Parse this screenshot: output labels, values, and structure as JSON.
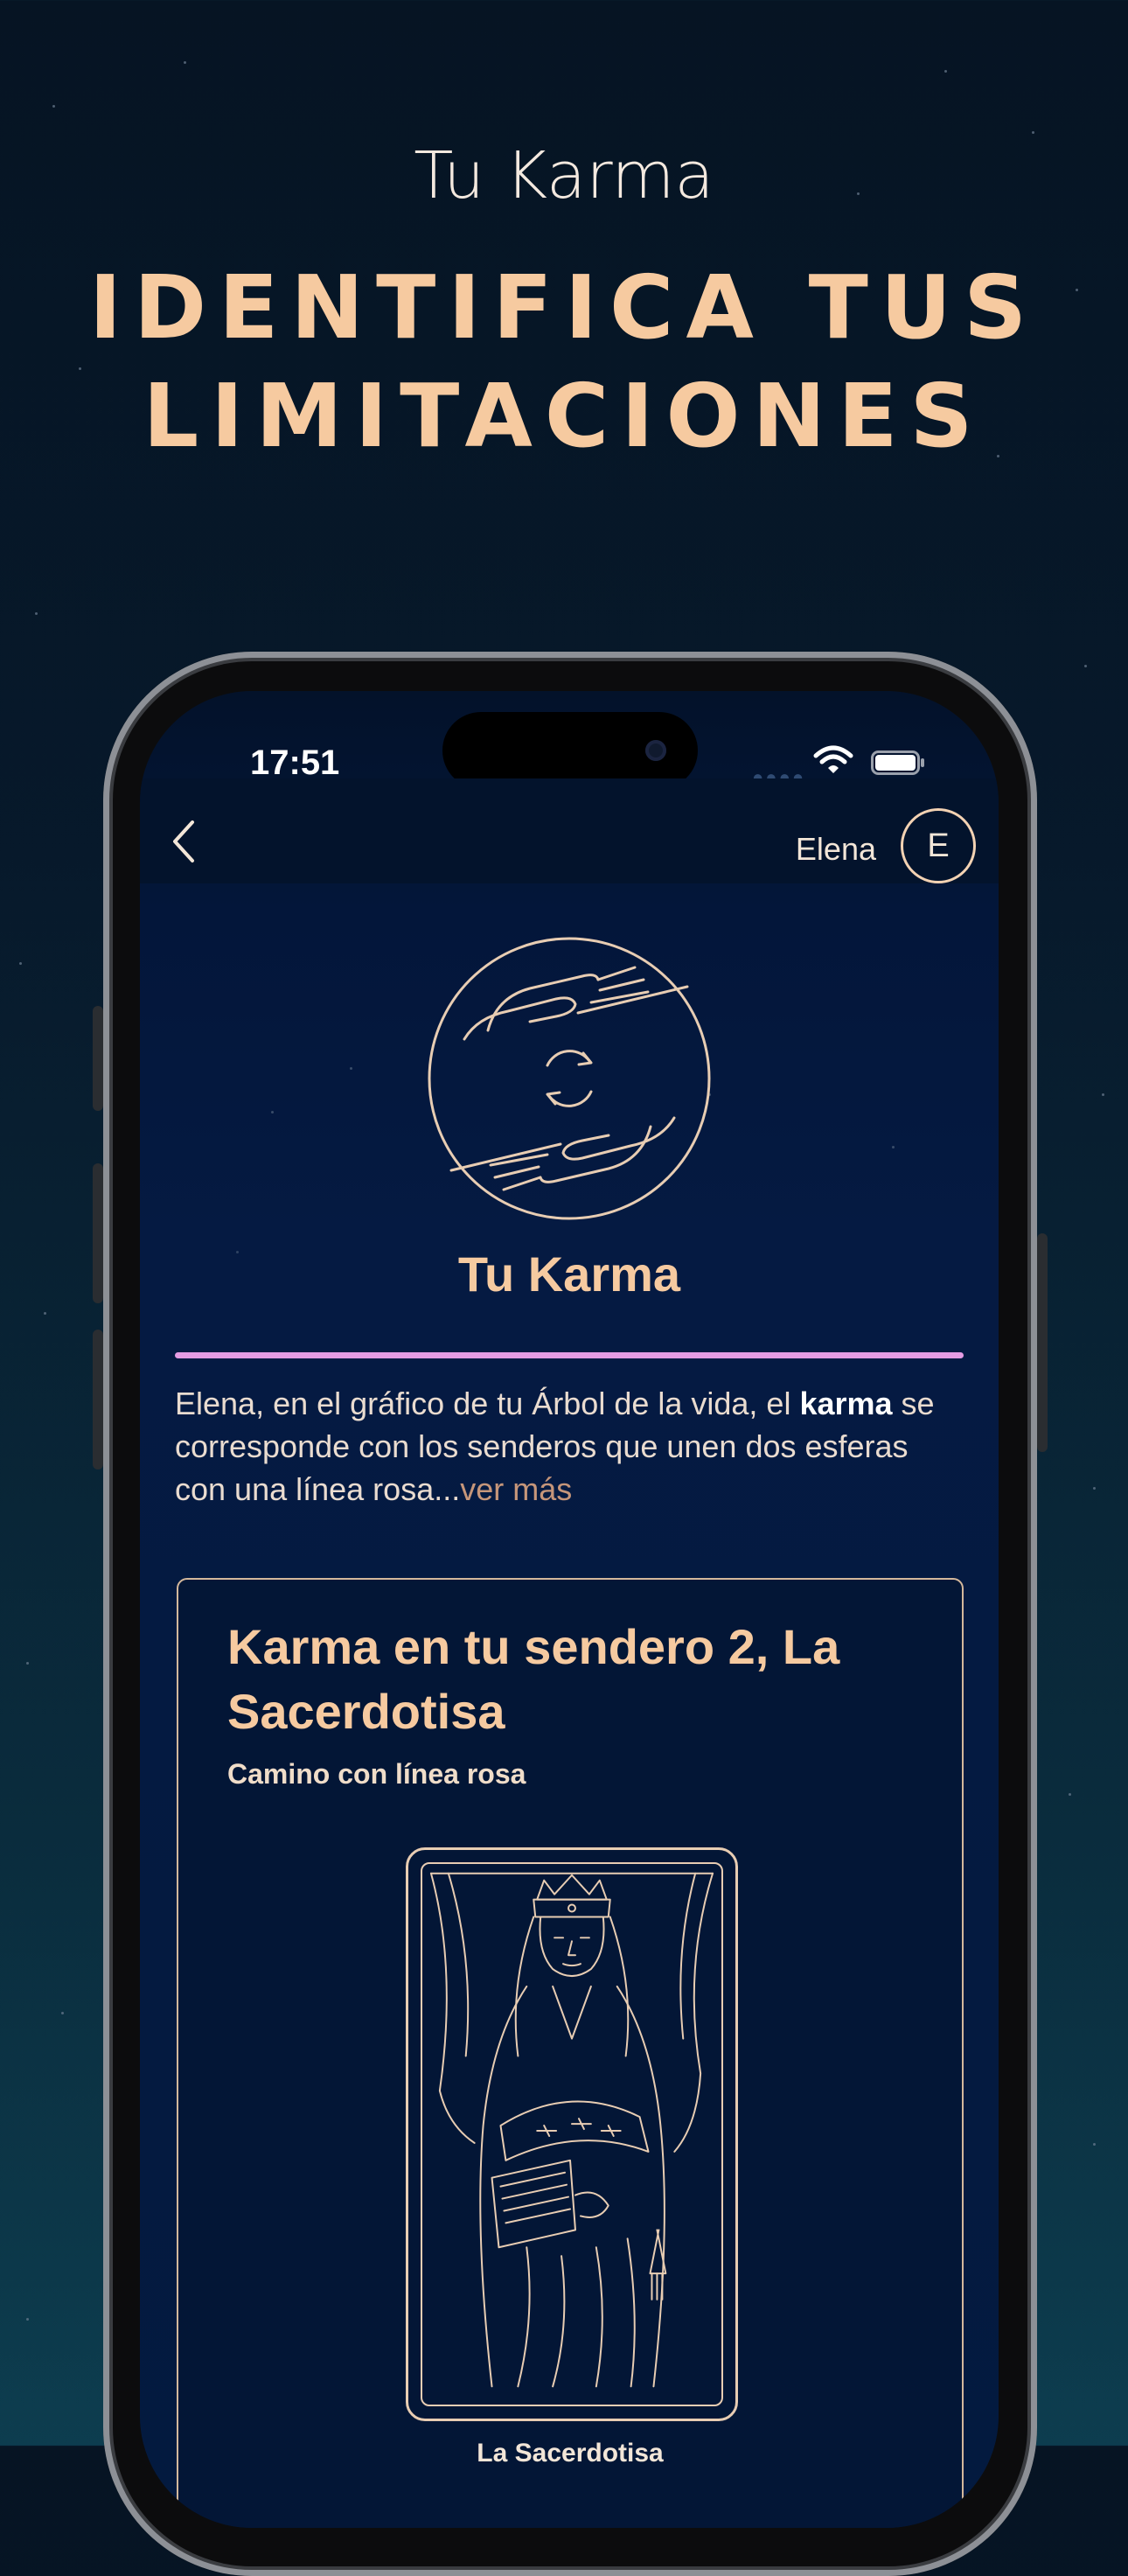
{
  "hero": {
    "eyebrow": "Tu Karma",
    "headline_line1": "IDENTIFICA TUS",
    "headline_line2": "LIMITACIONES"
  },
  "status_bar": {
    "time": "17:51",
    "icons": [
      "signal-dots-icon",
      "wifi-icon",
      "battery-icon"
    ]
  },
  "nav": {
    "back_icon": "chevron-left-icon",
    "user_name": "Elena",
    "avatar_initial": "E"
  },
  "section": {
    "emblem_icon": "karma-hands-icon",
    "title": "Tu Karma",
    "divider_color": "#e59ce3",
    "intro_before_bold": "Elena, en el gráfico de tu Árbol de la vida, el ",
    "intro_bold": "karma",
    "intro_after_bold": " se corresponde con los senderos que unen dos esferas con una línea rosa...",
    "read_more": "ver más"
  },
  "karma_card": {
    "title": "Karma en tu sendero 2, La Sacerdotisa",
    "subtitle": "Camino con línea rosa",
    "tarot_image": "la-sacerdotisa-tarot-illustration",
    "tarot_caption": "La Sacerdotisa"
  },
  "colors": {
    "accent_peach": "#f6caa0",
    "background": "#061423",
    "screen_background": "#051a42",
    "line_gold": "#e8cdb3"
  }
}
